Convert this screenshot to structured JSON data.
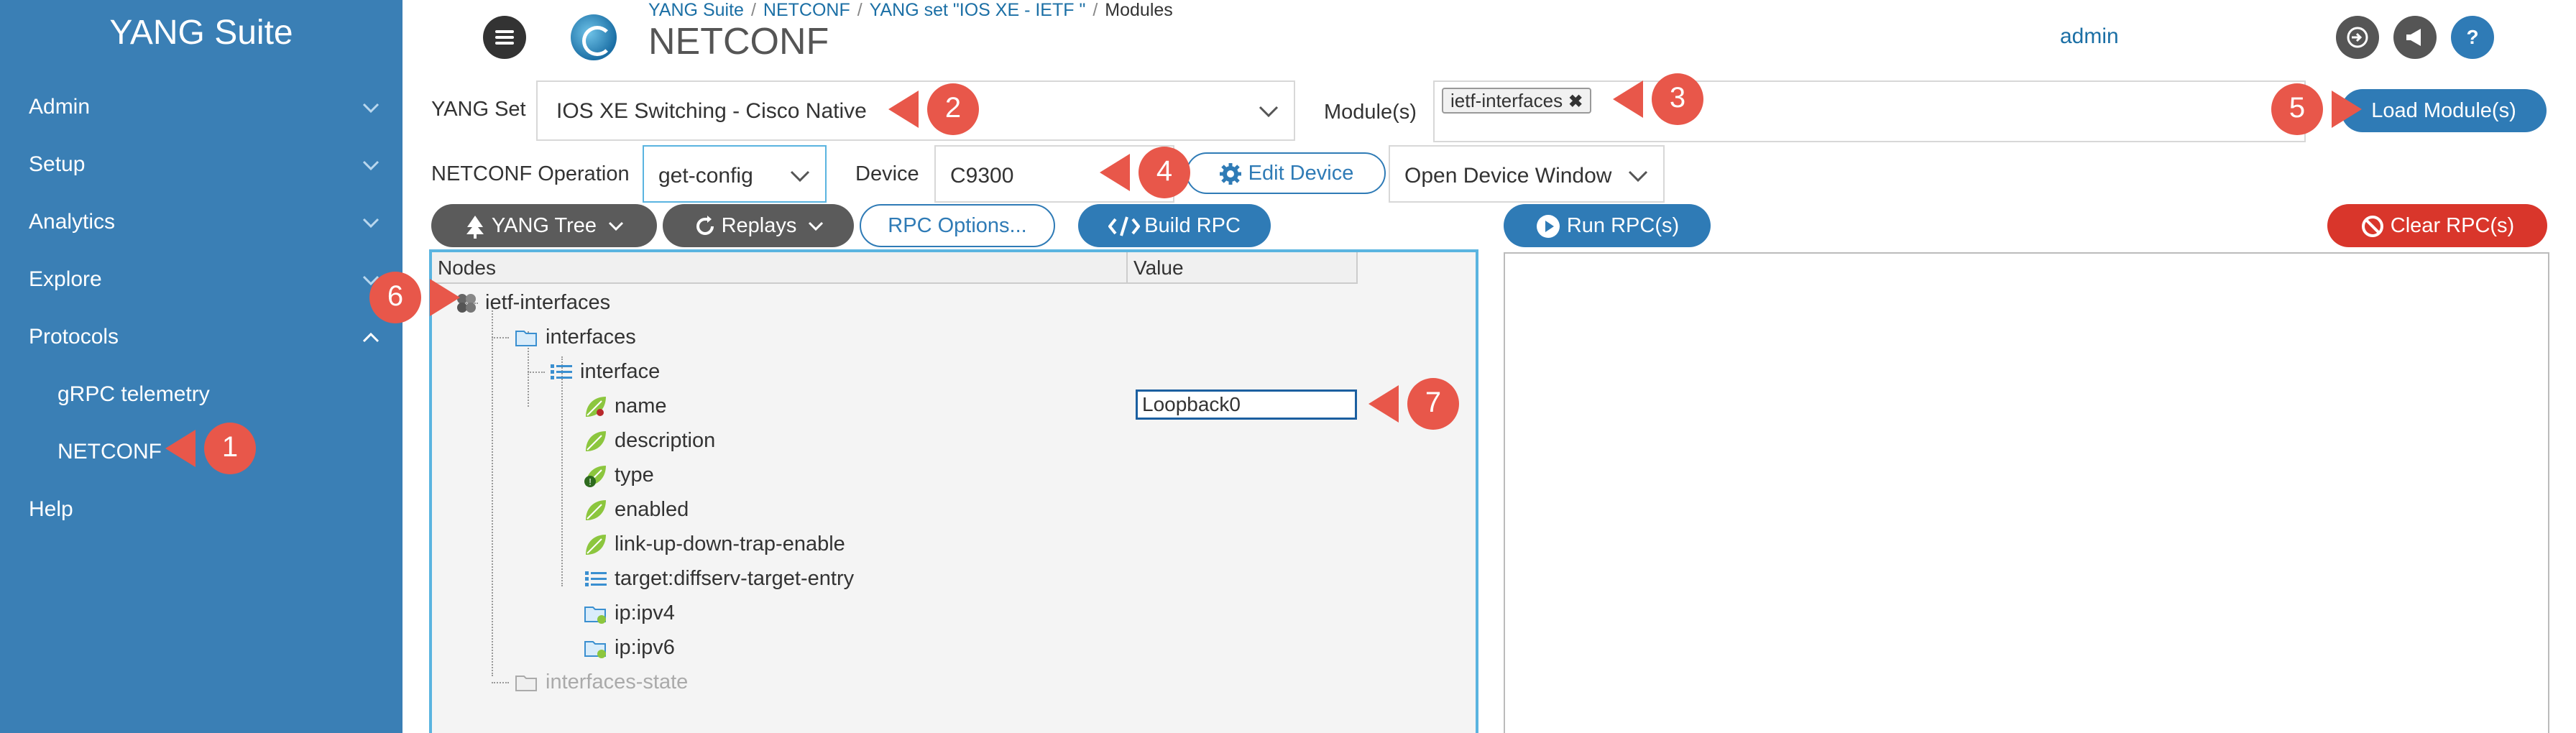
{
  "sidebar": {
    "brand": "YANG Suite",
    "items": [
      {
        "label": "Admin"
      },
      {
        "label": "Setup"
      },
      {
        "label": "Analytics"
      },
      {
        "label": "Explore"
      },
      {
        "label": "Protocols"
      },
      {
        "label": "gRPC telemetry"
      },
      {
        "label": "NETCONF"
      },
      {
        "label": "Help"
      }
    ]
  },
  "header": {
    "breadcrumb": [
      "YANG Suite",
      "NETCONF",
      "YANG set \"IOS XE - IETF \"",
      "Modules"
    ],
    "title": "NETCONF",
    "user": "admin",
    "icons": [
      "logout-icon",
      "announce-icon",
      "help-icon"
    ],
    "help_glyph": "?"
  },
  "form": {
    "yang_set_label": "YANG Set",
    "yang_set_value": "IOS XE Switching - Cisco Native",
    "modules_label": "Module(s)",
    "module_tag": "ietf-interfaces",
    "module_tag_remove": "✖",
    "load_button": "Load Module(s)",
    "operation_label": "NETCONF Operation",
    "operation_value": "get-config",
    "device_label": "Device",
    "device_value": "C9300",
    "edit_device": "Edit Device",
    "open_device_window": "Open Device Window"
  },
  "toolbar": {
    "yang_tree": "YANG Tree",
    "replays": "Replays",
    "rpc_options": "RPC Options...",
    "build_rpc": "Build RPC",
    "run_rpc": "Run RPC(s)",
    "clear_rpc": "Clear RPC(s)"
  },
  "tree": {
    "col_nodes": "Nodes",
    "col_value": "Value",
    "nodes": [
      {
        "label": "ietf-interfaces",
        "icon": "module-icon"
      },
      {
        "label": "interfaces",
        "icon": "container-icon"
      },
      {
        "label": "interface",
        "icon": "list-icon"
      },
      {
        "label": "name",
        "icon": "leaf-key-icon"
      },
      {
        "label": "description",
        "icon": "leaf-icon"
      },
      {
        "label": "type",
        "icon": "leaf-mandatory-icon",
        "badge": "!"
      },
      {
        "label": "enabled",
        "icon": "leaf-icon"
      },
      {
        "label": "link-up-down-trap-enable",
        "icon": "leaf-icon"
      },
      {
        "label": "target:diffserv-target-entry",
        "icon": "list-icon"
      },
      {
        "label": "ip:ipv4",
        "icon": "container-icon"
      },
      {
        "label": "ip:ipv6",
        "icon": "container-icon"
      },
      {
        "label": "interfaces-state",
        "icon": "container-icon"
      }
    ],
    "name_value": "Loopback0"
  },
  "callouts": [
    "1",
    "2",
    "3",
    "4",
    "5",
    "6",
    "7"
  ],
  "colors": {
    "sidebar": "#3a7fb5",
    "primary": "#2f7bb6",
    "danger": "#d9362b",
    "callout": "#e8574a",
    "leaf": "#8cc63e"
  }
}
